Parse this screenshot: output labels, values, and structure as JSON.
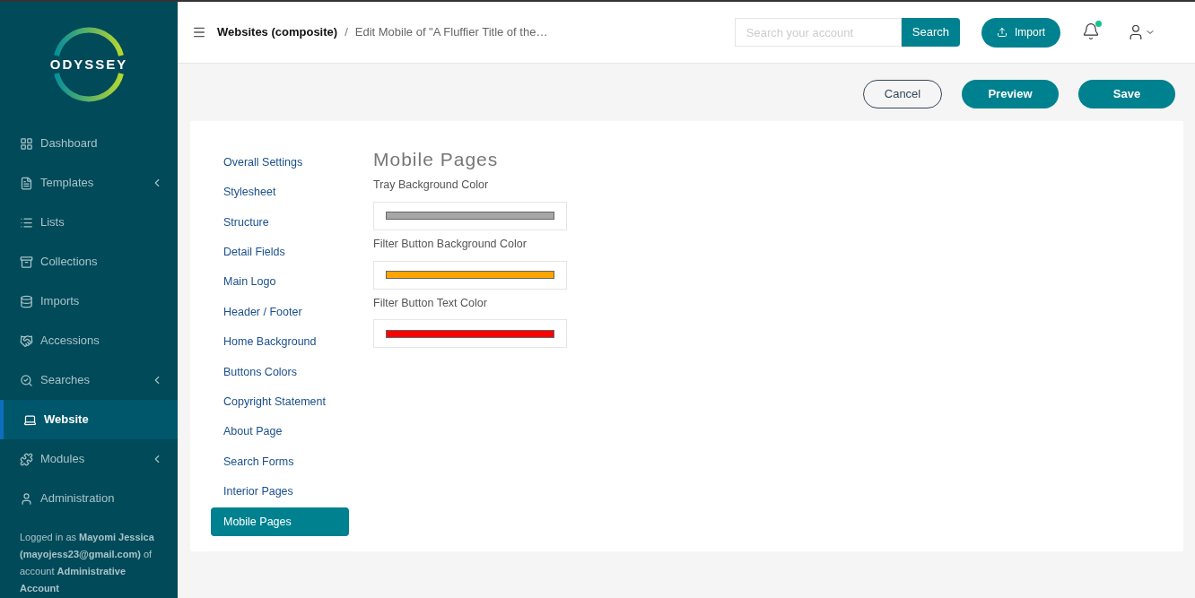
{
  "sidebar": {
    "logo": "ODYSSEY",
    "items": [
      {
        "label": "Dashboard",
        "expandable": false,
        "selected": false
      },
      {
        "label": "Templates",
        "expandable": true,
        "selected": false
      },
      {
        "label": "Lists",
        "expandable": false,
        "selected": false
      },
      {
        "label": "Collections",
        "expandable": false,
        "selected": false
      },
      {
        "label": "Imports",
        "expandable": false,
        "selected": false
      },
      {
        "label": "Accessions",
        "expandable": false,
        "selected": false
      },
      {
        "label": "Searches",
        "expandable": true,
        "selected": false
      },
      {
        "label": "Website",
        "expandable": false,
        "selected": true
      },
      {
        "label": "Modules",
        "expandable": true,
        "selected": false
      },
      {
        "label": "Administration",
        "expandable": false,
        "selected": false
      }
    ],
    "footer": "Logged in as **Mayomi Jessica (mayojess23@gmail.com)** of account **Administrative Account**"
  },
  "header": {
    "breadcrumb": [
      "Websites (composite)",
      "/",
      "Edit Mobile of \"A Fluffier Title of the…"
    ],
    "search": {
      "placeholder": "Search your account",
      "button": "Search"
    },
    "import": "Import",
    "notification": true
  },
  "actions": [
    "Cancel",
    "Preview",
    "Save"
  ],
  "settings_nav": [
    {
      "label": "Overall Settings",
      "selected": false
    },
    {
      "label": "Stylesheet",
      "selected": false
    },
    {
      "label": "Structure",
      "selected": false
    },
    {
      "label": "Detail Fields",
      "selected": false
    },
    {
      "label": "Main Logo",
      "selected": false
    },
    {
      "label": "Header / Footer",
      "selected": false
    },
    {
      "label": "Home Background",
      "selected": false
    },
    {
      "label": "Buttons Colors",
      "selected": false
    },
    {
      "label": "Copyright Statement",
      "selected": false
    },
    {
      "label": "About Page",
      "selected": false
    },
    {
      "label": "Search Forms",
      "selected": false
    },
    {
      "label": "Interior Pages",
      "selected": false
    },
    {
      "label": "Mobile Pages",
      "selected": true
    }
  ],
  "panel": {
    "title": "Mobile Pages",
    "fields": [
      {
        "label": "Tray Background Color",
        "color": "#a6a6a6"
      },
      {
        "label": "Filter Button Background Color",
        "color": "#ffa500"
      },
      {
        "label": "Filter Button Text Color",
        "color": "#ff0000"
      }
    ]
  }
}
